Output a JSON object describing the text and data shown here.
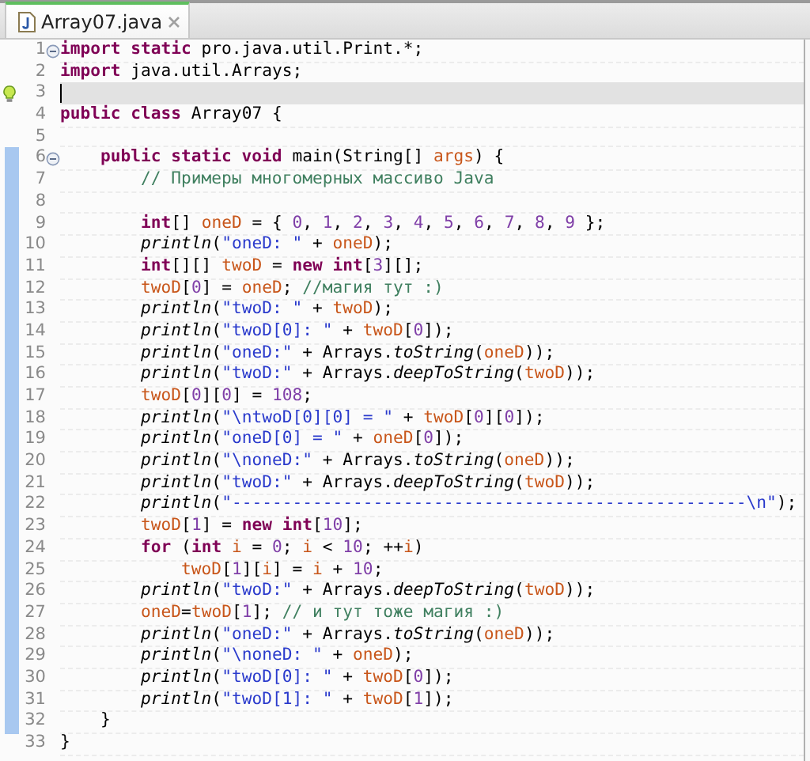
{
  "tabs": [
    {
      "title": "Array07.java",
      "selected": true
    }
  ],
  "lines": [
    {
      "number": "1",
      "folded": false,
      "scope": false,
      "current": false,
      "tokens": [
        {
          "kind": "kw",
          "text": "import static"
        },
        {
          "kind": "plain",
          "text": " pro.java.util.Print.*;"
        }
      ]
    },
    {
      "number": "2",
      "scope": false,
      "current": false,
      "tokens": [
        {
          "kind": "kw",
          "text": "import"
        },
        {
          "kind": "plain",
          "text": " java.util.Arrays;"
        }
      ]
    },
    {
      "number": "3",
      "quick_fix": true,
      "scope": false,
      "current": true
    },
    {
      "number": "4",
      "scope": false,
      "current": false,
      "tokens": [
        {
          "kind": "kw",
          "text": "public class"
        },
        {
          "kind": "plain",
          "text": " Array07 {"
        }
      ]
    },
    {
      "number": "5",
      "scope": false,
      "current": false
    },
    {
      "number": "6",
      "folded": false,
      "scope": true,
      "current": false,
      "tokens": [
        {
          "kind": "kw",
          "text": "    public static void"
        },
        {
          "kind": "plain",
          "text": " main(String[] "
        },
        {
          "kind": "var",
          "text": "args"
        },
        {
          "kind": "plain",
          "text": ") {"
        }
      ]
    },
    {
      "number": "7",
      "scope": true,
      "current": false,
      "tokens": [
        {
          "kind": "com",
          "text": "        // Примеры многомерных массиво Java"
        }
      ]
    },
    {
      "number": "8",
      "scope": true,
      "current": false
    },
    {
      "number": "9",
      "scope": true,
      "current": false,
      "tokens": [
        {
          "kind": "kw",
          "text": "        int"
        },
        {
          "kind": "plain",
          "text": "[] "
        },
        {
          "kind": "var",
          "text": "oneD"
        },
        {
          "kind": "plain",
          "text": " = { "
        },
        {
          "kind": "num",
          "text": "0"
        },
        {
          "kind": "plain",
          "text": ", "
        },
        {
          "kind": "num",
          "text": "1"
        },
        {
          "kind": "plain",
          "text": ", "
        },
        {
          "kind": "num",
          "text": "2"
        },
        {
          "kind": "plain",
          "text": ", "
        },
        {
          "kind": "num",
          "text": "3"
        },
        {
          "kind": "plain",
          "text": ", "
        },
        {
          "kind": "num",
          "text": "4"
        },
        {
          "kind": "plain",
          "text": ", "
        },
        {
          "kind": "num",
          "text": "5"
        },
        {
          "kind": "plain",
          "text": ", "
        },
        {
          "kind": "num",
          "text": "6"
        },
        {
          "kind": "plain",
          "text": ", "
        },
        {
          "kind": "num",
          "text": "7"
        },
        {
          "kind": "plain",
          "text": ", "
        },
        {
          "kind": "num",
          "text": "8"
        },
        {
          "kind": "plain",
          "text": ", "
        },
        {
          "kind": "num",
          "text": "9"
        },
        {
          "kind": "plain",
          "text": " };"
        }
      ]
    },
    {
      "number": "10",
      "scope": true,
      "current": false,
      "tokens": [
        {
          "kind": "call",
          "text": "        println"
        },
        {
          "kind": "plain",
          "text": "("
        },
        {
          "kind": "str",
          "text": "\"oneD: \""
        },
        {
          "kind": "plain",
          "text": " + "
        },
        {
          "kind": "var",
          "text": "oneD"
        },
        {
          "kind": "plain",
          "text": ");"
        }
      ]
    },
    {
      "number": "11",
      "scope": true,
      "current": false,
      "tokens": [
        {
          "kind": "kw",
          "text": "        int"
        },
        {
          "kind": "plain",
          "text": "[][] "
        },
        {
          "kind": "var",
          "text": "twoD"
        },
        {
          "kind": "plain",
          "text": " = "
        },
        {
          "kind": "kw",
          "text": "new int"
        },
        {
          "kind": "plain",
          "text": "["
        },
        {
          "kind": "num",
          "text": "3"
        },
        {
          "kind": "plain",
          "text": "][];"
        }
      ]
    },
    {
      "number": "12",
      "scope": true,
      "current": false,
      "tokens": [
        {
          "kind": "var",
          "text": "        twoD"
        },
        {
          "kind": "plain",
          "text": "["
        },
        {
          "kind": "num",
          "text": "0"
        },
        {
          "kind": "plain",
          "text": "] = "
        },
        {
          "kind": "var",
          "text": "oneD"
        },
        {
          "kind": "plain",
          "text": "; "
        },
        {
          "kind": "com",
          "text": "//магия тут :)"
        }
      ]
    },
    {
      "number": "13",
      "scope": true,
      "current": false,
      "tokens": [
        {
          "kind": "call",
          "text": "        println"
        },
        {
          "kind": "plain",
          "text": "("
        },
        {
          "kind": "str",
          "text": "\"twoD: \""
        },
        {
          "kind": "plain",
          "text": " + "
        },
        {
          "kind": "var",
          "text": "twoD"
        },
        {
          "kind": "plain",
          "text": ");"
        }
      ]
    },
    {
      "number": "14",
      "scope": true,
      "current": false,
      "tokens": [
        {
          "kind": "call",
          "text": "        println"
        },
        {
          "kind": "plain",
          "text": "("
        },
        {
          "kind": "str",
          "text": "\"twoD[0]: \""
        },
        {
          "kind": "plain",
          "text": " + "
        },
        {
          "kind": "var",
          "text": "twoD"
        },
        {
          "kind": "plain",
          "text": "["
        },
        {
          "kind": "num",
          "text": "0"
        },
        {
          "kind": "plain",
          "text": "]);"
        }
      ]
    },
    {
      "number": "15",
      "scope": true,
      "current": false,
      "tokens": [
        {
          "kind": "call",
          "text": "        println"
        },
        {
          "kind": "plain",
          "text": "("
        },
        {
          "kind": "str",
          "text": "\"oneD:\""
        },
        {
          "kind": "plain",
          "text": " + Arrays."
        },
        {
          "kind": "method",
          "text": "toString"
        },
        {
          "kind": "plain",
          "text": "("
        },
        {
          "kind": "var",
          "text": "oneD"
        },
        {
          "kind": "plain",
          "text": "));"
        }
      ]
    },
    {
      "number": "16",
      "scope": true,
      "current": false,
      "tokens": [
        {
          "kind": "call",
          "text": "        println"
        },
        {
          "kind": "plain",
          "text": "("
        },
        {
          "kind": "str",
          "text": "\"twoD:\""
        },
        {
          "kind": "plain",
          "text": " + Arrays."
        },
        {
          "kind": "method",
          "text": "deepToString"
        },
        {
          "kind": "plain",
          "text": "("
        },
        {
          "kind": "var",
          "text": "twoD"
        },
        {
          "kind": "plain",
          "text": "));"
        }
      ]
    },
    {
      "number": "17",
      "scope": true,
      "current": false,
      "tokens": [
        {
          "kind": "var",
          "text": "        twoD"
        },
        {
          "kind": "plain",
          "text": "["
        },
        {
          "kind": "num",
          "text": "0"
        },
        {
          "kind": "plain",
          "text": "]["
        },
        {
          "kind": "num",
          "text": "0"
        },
        {
          "kind": "plain",
          "text": "] = "
        },
        {
          "kind": "num",
          "text": "108"
        },
        {
          "kind": "plain",
          "text": ";"
        }
      ]
    },
    {
      "number": "18",
      "scope": true,
      "current": false,
      "tokens": [
        {
          "kind": "call",
          "text": "        println"
        },
        {
          "kind": "plain",
          "text": "("
        },
        {
          "kind": "str",
          "text": "\"\\ntwoD[0][0] = \""
        },
        {
          "kind": "plain",
          "text": " + "
        },
        {
          "kind": "var",
          "text": "twoD"
        },
        {
          "kind": "plain",
          "text": "["
        },
        {
          "kind": "num",
          "text": "0"
        },
        {
          "kind": "plain",
          "text": "]["
        },
        {
          "kind": "num",
          "text": "0"
        },
        {
          "kind": "plain",
          "text": "]);"
        }
      ]
    },
    {
      "number": "19",
      "scope": true,
      "current": false,
      "tokens": [
        {
          "kind": "call",
          "text": "        println"
        },
        {
          "kind": "plain",
          "text": "("
        },
        {
          "kind": "str",
          "text": "\"oneD[0] = \""
        },
        {
          "kind": "plain",
          "text": " + "
        },
        {
          "kind": "var",
          "text": "oneD"
        },
        {
          "kind": "plain",
          "text": "["
        },
        {
          "kind": "num",
          "text": "0"
        },
        {
          "kind": "plain",
          "text": "]);"
        }
      ]
    },
    {
      "number": "20",
      "scope": true,
      "current": false,
      "tokens": [
        {
          "kind": "call",
          "text": "        println"
        },
        {
          "kind": "plain",
          "text": "("
        },
        {
          "kind": "str",
          "text": "\"\\noneD:\""
        },
        {
          "kind": "plain",
          "text": " + Arrays."
        },
        {
          "kind": "method",
          "text": "toString"
        },
        {
          "kind": "plain",
          "text": "("
        },
        {
          "kind": "var",
          "text": "oneD"
        },
        {
          "kind": "plain",
          "text": "));"
        }
      ]
    },
    {
      "number": "21",
      "scope": true,
      "current": false,
      "tokens": [
        {
          "kind": "call",
          "text": "        println"
        },
        {
          "kind": "plain",
          "text": "("
        },
        {
          "kind": "str",
          "text": "\"twoD:\""
        },
        {
          "kind": "plain",
          "text": " + Arrays."
        },
        {
          "kind": "method",
          "text": "deepToString"
        },
        {
          "kind": "plain",
          "text": "("
        },
        {
          "kind": "var",
          "text": "twoD"
        },
        {
          "kind": "plain",
          "text": "));"
        }
      ]
    },
    {
      "number": "22",
      "scope": true,
      "current": false,
      "tokens": [
        {
          "kind": "call",
          "text": "        println"
        },
        {
          "kind": "plain",
          "text": "("
        },
        {
          "kind": "str",
          "text": "\"---------------------------------------------------\\n\""
        },
        {
          "kind": "plain",
          "text": ");"
        }
      ]
    },
    {
      "number": "23",
      "scope": true,
      "current": false,
      "tokens": [
        {
          "kind": "var",
          "text": "        twoD"
        },
        {
          "kind": "plain",
          "text": "["
        },
        {
          "kind": "num",
          "text": "1"
        },
        {
          "kind": "plain",
          "text": "] = "
        },
        {
          "kind": "kw",
          "text": "new int"
        },
        {
          "kind": "plain",
          "text": "["
        },
        {
          "kind": "num",
          "text": "10"
        },
        {
          "kind": "plain",
          "text": "];"
        }
      ]
    },
    {
      "number": "24",
      "scope": true,
      "current": false,
      "tokens": [
        {
          "kind": "kw",
          "text": "        for"
        },
        {
          "kind": "plain",
          "text": " ("
        },
        {
          "kind": "kw",
          "text": "int"
        },
        {
          "kind": "var",
          "text": " i"
        },
        {
          "kind": "plain",
          "text": " = "
        },
        {
          "kind": "num",
          "text": "0"
        },
        {
          "kind": "plain",
          "text": "; "
        },
        {
          "kind": "var",
          "text": "i"
        },
        {
          "kind": "plain",
          "text": " < "
        },
        {
          "kind": "num",
          "text": "10"
        },
        {
          "kind": "plain",
          "text": "; ++"
        },
        {
          "kind": "var",
          "text": "i"
        },
        {
          "kind": "plain",
          "text": ")"
        }
      ]
    },
    {
      "number": "25",
      "scope": true,
      "current": false,
      "tokens": [
        {
          "kind": "var",
          "text": "            twoD"
        },
        {
          "kind": "plain",
          "text": "["
        },
        {
          "kind": "num",
          "text": "1"
        },
        {
          "kind": "plain",
          "text": "]["
        },
        {
          "kind": "var",
          "text": "i"
        },
        {
          "kind": "plain",
          "text": "] = "
        },
        {
          "kind": "var",
          "text": "i"
        },
        {
          "kind": "plain",
          "text": " + "
        },
        {
          "kind": "num",
          "text": "10"
        },
        {
          "kind": "plain",
          "text": ";"
        }
      ]
    },
    {
      "number": "26",
      "scope": true,
      "current": false,
      "tokens": [
        {
          "kind": "call",
          "text": "        println"
        },
        {
          "kind": "plain",
          "text": "("
        },
        {
          "kind": "str",
          "text": "\"twoD:\""
        },
        {
          "kind": "plain",
          "text": " + Arrays."
        },
        {
          "kind": "method",
          "text": "deepToString"
        },
        {
          "kind": "plain",
          "text": "("
        },
        {
          "kind": "var",
          "text": "twoD"
        },
        {
          "kind": "plain",
          "text": "));"
        }
      ]
    },
    {
      "number": "27",
      "scope": true,
      "current": false,
      "tokens": [
        {
          "kind": "var",
          "text": "        oneD"
        },
        {
          "kind": "plain",
          "text": "="
        },
        {
          "kind": "var",
          "text": "twoD"
        },
        {
          "kind": "plain",
          "text": "["
        },
        {
          "kind": "num",
          "text": "1"
        },
        {
          "kind": "plain",
          "text": "]; "
        },
        {
          "kind": "com",
          "text": "// и тут тоже магия :)"
        }
      ]
    },
    {
      "number": "28",
      "scope": true,
      "current": false,
      "tokens": [
        {
          "kind": "call",
          "text": "        println"
        },
        {
          "kind": "plain",
          "text": "("
        },
        {
          "kind": "str",
          "text": "\"oneD:\""
        },
        {
          "kind": "plain",
          "text": " + Arrays."
        },
        {
          "kind": "method",
          "text": "toString"
        },
        {
          "kind": "plain",
          "text": "("
        },
        {
          "kind": "var",
          "text": "oneD"
        },
        {
          "kind": "plain",
          "text": "));"
        }
      ]
    },
    {
      "number": "29",
      "scope": true,
      "current": false,
      "tokens": [
        {
          "kind": "call",
          "text": "        println"
        },
        {
          "kind": "plain",
          "text": "("
        },
        {
          "kind": "str",
          "text": "\"\\noneD: \""
        },
        {
          "kind": "plain",
          "text": " + "
        },
        {
          "kind": "var",
          "text": "oneD"
        },
        {
          "kind": "plain",
          "text": ");"
        }
      ]
    },
    {
      "number": "30",
      "scope": true,
      "current": false,
      "tokens": [
        {
          "kind": "call",
          "text": "        println"
        },
        {
          "kind": "plain",
          "text": "("
        },
        {
          "kind": "str",
          "text": "\"twoD[0]: \""
        },
        {
          "kind": "plain",
          "text": " + "
        },
        {
          "kind": "var",
          "text": "twoD"
        },
        {
          "kind": "plain",
          "text": "["
        },
        {
          "kind": "num",
          "text": "0"
        },
        {
          "kind": "plain",
          "text": "]);"
        }
      ]
    },
    {
      "number": "31",
      "scope": true,
      "current": false,
      "tokens": [
        {
          "kind": "call",
          "text": "        println"
        },
        {
          "kind": "plain",
          "text": "("
        },
        {
          "kind": "str",
          "text": "\"twoD[1]: \""
        },
        {
          "kind": "plain",
          "text": " + "
        },
        {
          "kind": "var",
          "text": "twoD"
        },
        {
          "kind": "plain",
          "text": "["
        },
        {
          "kind": "num",
          "text": "1"
        },
        {
          "kind": "plain",
          "text": "]);"
        }
      ]
    },
    {
      "number": "32",
      "scope": true,
      "current": false,
      "tokens": [
        {
          "kind": "plain",
          "text": "    }"
        }
      ]
    },
    {
      "number": "33",
      "scope": false,
      "current": false,
      "tokens": [
        {
          "kind": "plain",
          "text": "}"
        }
      ]
    }
  ]
}
